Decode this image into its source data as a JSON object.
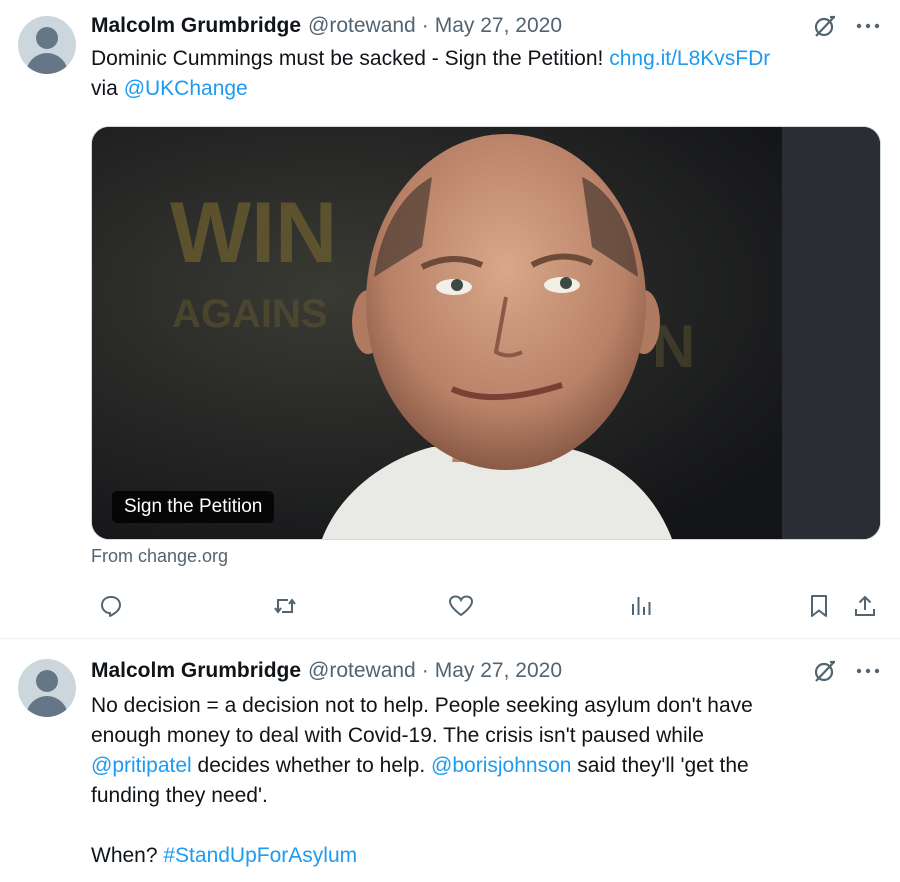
{
  "tweets": [
    {
      "author_name": "Malcolm Grumbridge",
      "handle": "@rotewand",
      "separator": "·",
      "date": "May 27, 2020",
      "text_plain_1": "Dominic Cummings must be sacked - Sign the Petition! ",
      "link_url_text": "chng.it/L8KvsFDr",
      "text_plain_2": "via ",
      "mention": "@UKChange",
      "card": {
        "label": "Sign the Petition",
        "source": "From change.org",
        "background_text_1": "WIN",
        "background_text_2": "AGAINS",
        "background_text_3": "N"
      }
    },
    {
      "author_name": "Malcolm Grumbridge",
      "handle": "@rotewand",
      "separator": "·",
      "date": "May 27, 2020",
      "line1": "No decision = a decision not to help. People seeking asylum don't have",
      "line2": "enough money to deal with Covid-19. The crisis isn't paused while",
      "mention1": "@pritipatel",
      "line3_rest": " decides whether to help. ",
      "mention2": "@borisjohnson",
      "line3_end": " said they'll 'get the",
      "line4": "funding they need'.",
      "line6_prefix": "When? ",
      "hashtag": "#StandUpForAsylum"
    }
  ],
  "icons": {
    "more": "more-icon",
    "grok": "grok-icon",
    "reply": "reply-icon",
    "retweet": "retweet-icon",
    "like": "like-icon",
    "views": "views-icon",
    "bookmark": "bookmark-icon",
    "share": "share-icon"
  },
  "colors": {
    "link": "#1d9bf0",
    "secondary_text": "#536471",
    "primary_text": "#0f1419"
  }
}
